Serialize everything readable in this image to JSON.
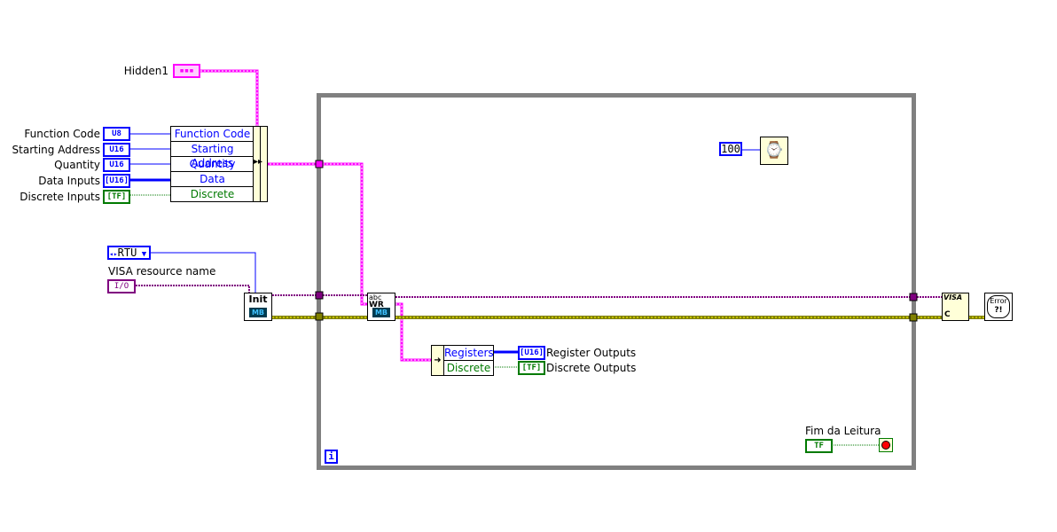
{
  "hidden": {
    "label": "Hidden1"
  },
  "inputs": [
    {
      "label": "Function Code",
      "type": "U8"
    },
    {
      "label": "Starting Address",
      "type": "U16"
    },
    {
      "label": "Quantity",
      "type": "U16"
    },
    {
      "label": "Data Inputs",
      "type": "[U16]"
    },
    {
      "label": "Discrete Inputs",
      "type": "[TF]"
    }
  ],
  "bundle": {
    "rows": [
      "Function Code",
      "Starting Address",
      "Quantity",
      "Data",
      "Discrete"
    ]
  },
  "mode": {
    "value": "RTU"
  },
  "visa": {
    "label": "VISA resource name",
    "type": "I/O"
  },
  "init": {
    "label": "Init",
    "badge": "MB"
  },
  "wr": {
    "top": "abc",
    "label": "WR",
    "badge": "MB"
  },
  "unbundle": {
    "rows": [
      "Registers",
      "Discrete"
    ]
  },
  "outputs": [
    {
      "label": "Register Outputs",
      "type": "[U16]"
    },
    {
      "label": "Discrete Outputs",
      "type": "[TF]"
    }
  ],
  "wait": {
    "value": "100"
  },
  "stop": {
    "label": "Fim da Leitura",
    "type": "TF"
  },
  "loop": {
    "iteration": "i"
  },
  "close": {
    "label": "VISA",
    "sub": "C"
  },
  "error": {
    "label": "Error",
    "sub": "?!"
  },
  "colors": {
    "integer": "#0000ff",
    "boolean": "#007a00",
    "cluster": "#ff00ff",
    "visa": "#800080",
    "error": "#808000",
    "loop": "#808080"
  }
}
